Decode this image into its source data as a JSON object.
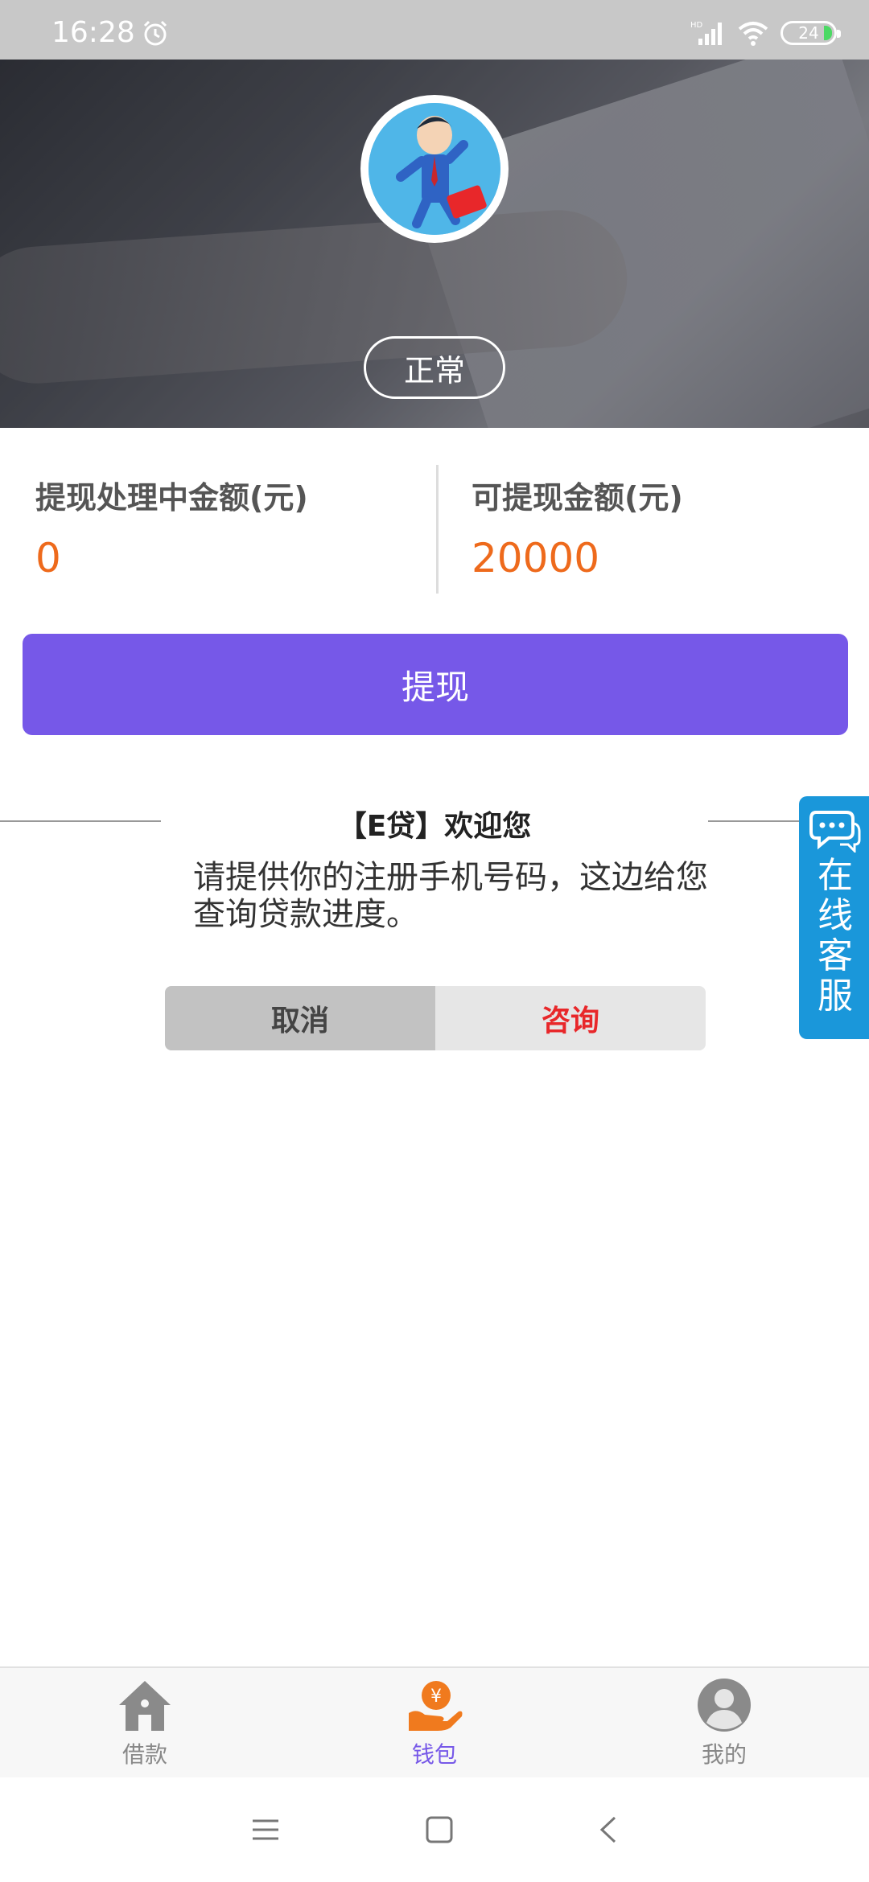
{
  "status_bar": {
    "time": "16:28",
    "battery": "24"
  },
  "profile": {
    "status": "正常"
  },
  "amounts": {
    "processing_label": "提现处理中金额(元)",
    "processing_value": "0",
    "available_label": "可提现金额(元)",
    "available_value": "20000"
  },
  "withdraw_button": "提现",
  "dialog": {
    "title": "【E贷】欢迎您",
    "message": "请提供你的注册手机号码，这边给您查询贷款进度。",
    "cancel": "取消",
    "consult": "咨询"
  },
  "service": {
    "label": "在线客服"
  },
  "bottom_nav": [
    {
      "label": "借款",
      "icon": "house-icon"
    },
    {
      "label": "钱包",
      "icon": "wallet-icon"
    },
    {
      "label": "我的",
      "icon": "user-icon"
    }
  ],
  "colors": {
    "accent": "#7658e8",
    "amount": "#ee6a1c",
    "consult": "#e8272a",
    "service": "#1a97da"
  }
}
